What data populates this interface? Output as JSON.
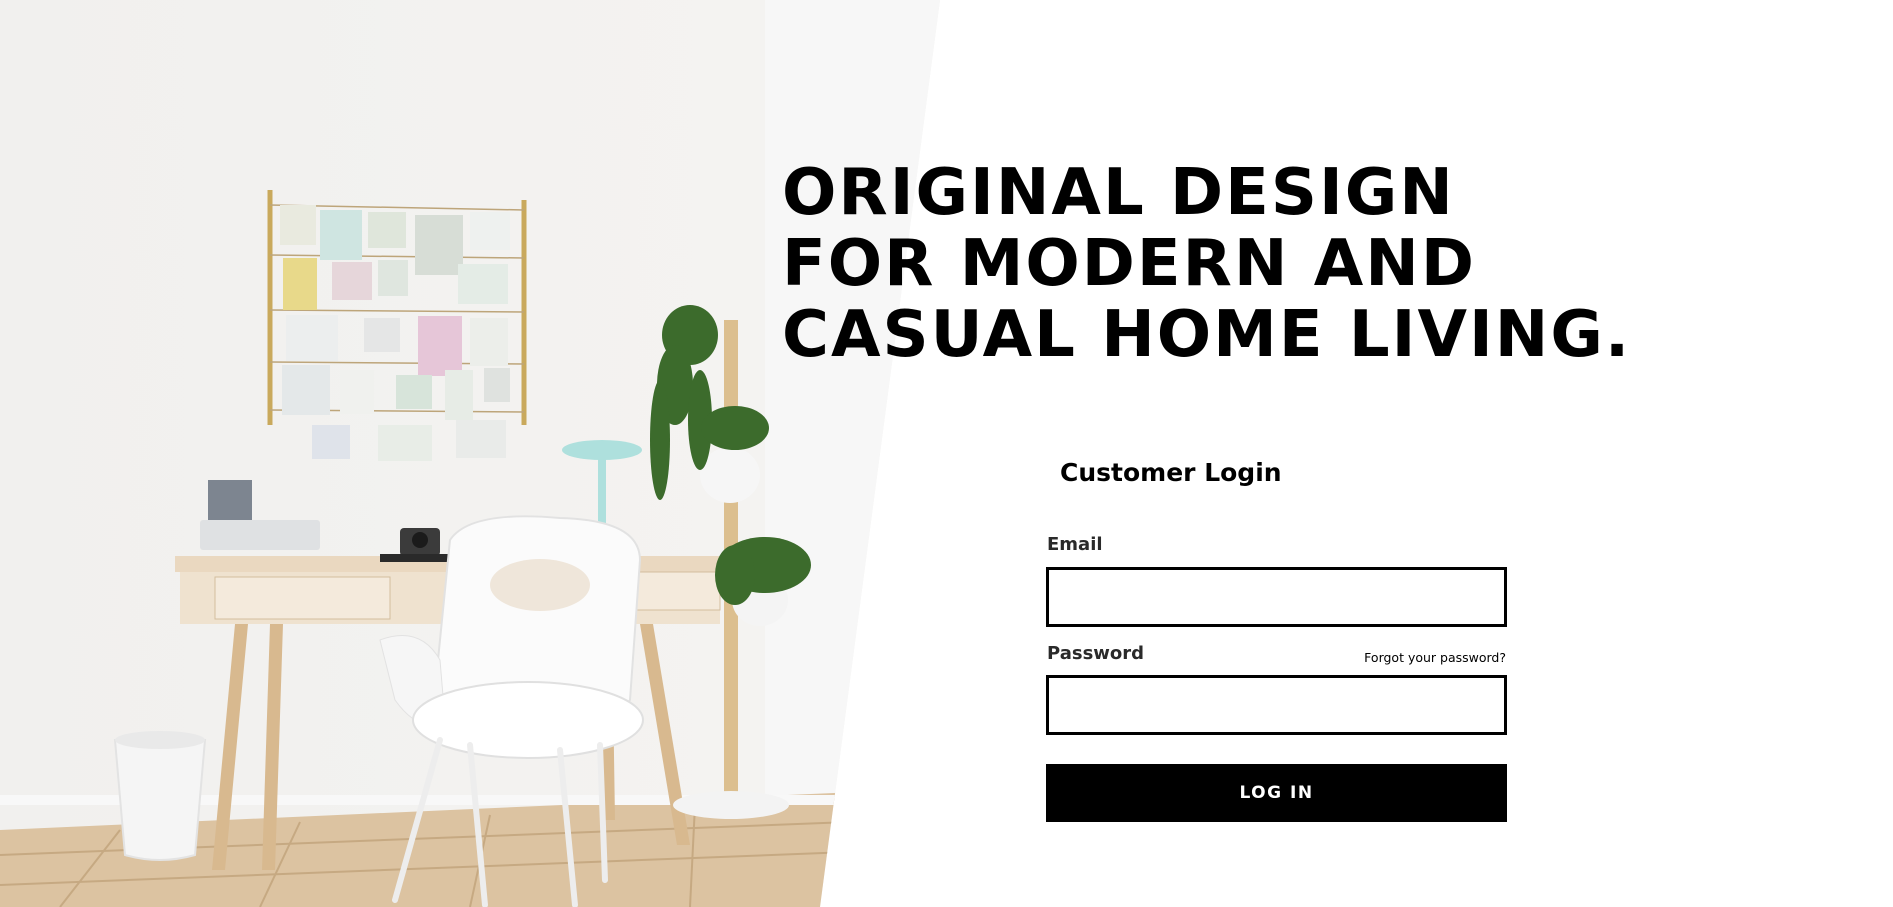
{
  "hero": {
    "headline_lines": [
      "ORIGINAL DESIGN",
      "FOR MODERN AND",
      "CASUAL HOME LIVING."
    ]
  },
  "login": {
    "title": "Customer Login",
    "email_label": "Email",
    "email_value": "",
    "email_placeholder": "",
    "password_label": "Password",
    "password_value": "",
    "password_placeholder": "",
    "forgot_link": "Forgot your password?",
    "submit_label": "LOG IN"
  },
  "colors": {
    "primary": "#000000",
    "background": "#ffffff",
    "wall": "#f2f1ef",
    "floor": "#dcc3a1"
  }
}
